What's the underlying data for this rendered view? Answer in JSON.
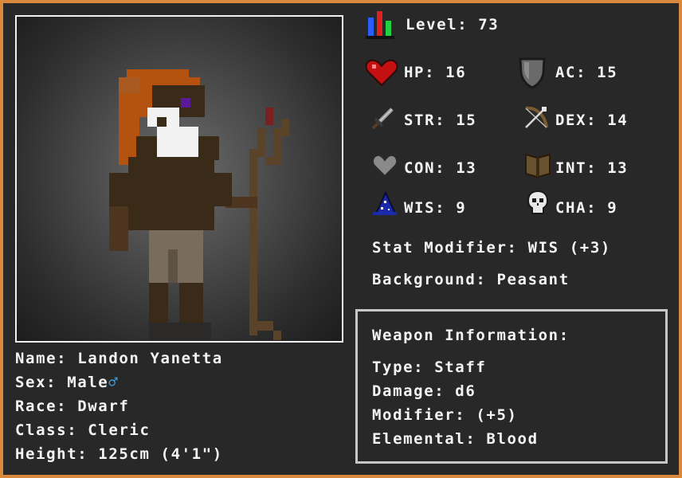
{
  "stats": {
    "level": "Level: 73",
    "hp": "HP: 16",
    "ac": "AC: 15",
    "str": "STR: 15",
    "dex": "DEX: 14",
    "con": "CON: 13",
    "int": "INT: 13",
    "wis": "WIS: 9",
    "cha": "CHA: 9",
    "modifier": "Stat Modifier: WIS (+3)",
    "background": "Background: Peasant"
  },
  "weapon": {
    "heading": "Weapon Information:",
    "type": "Type: Staff",
    "damage": "Damage: d6",
    "modifier": "Modifier: (+5)",
    "elemental": "Elemental: Blood"
  },
  "character": {
    "name": "Name: Landon Yanetta",
    "sex": "Sex: Male",
    "sex_symbol": "♂",
    "race": "Race: Dwarf",
    "class": "Class: Cleric",
    "height": "Height: 125cm (4'1\")"
  },
  "icons": {
    "level": "bar-chart-icon",
    "hp": "heart-icon",
    "ac": "shield-icon",
    "str": "sword-icon",
    "dex": "bow-icon",
    "con": "grey-heart-icon",
    "int": "book-icon",
    "wis": "wizard-hat-icon",
    "cha": "skull-icon"
  },
  "colors": {
    "frame": "#d9883c",
    "panel": "#282828",
    "text": "#f4f4f4",
    "male_symbol": "#3fa0e6"
  }
}
